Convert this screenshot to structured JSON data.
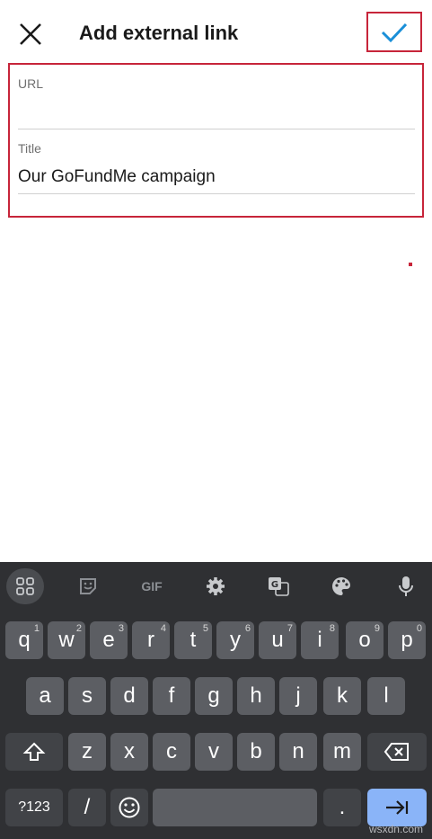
{
  "header": {
    "title": "Add external link",
    "close_icon": "close-icon",
    "confirm_icon": "check-icon"
  },
  "form": {
    "url_label": "URL",
    "url_value": "",
    "title_label": "Title",
    "title_value": "Our GoFundMe campaign"
  },
  "keyboard": {
    "toolbar": {
      "gif_label": "GIF",
      "icons": [
        "apps-grid-icon",
        "sticker-icon",
        "settings-gear-icon",
        "translate-icon",
        "palette-icon",
        "microphone-icon"
      ]
    },
    "row1": [
      "q",
      "w",
      "e",
      "r",
      "t",
      "y",
      "u",
      "i",
      "o",
      "p"
    ],
    "row1_hints": [
      "1",
      "2",
      "3",
      "4",
      "5",
      "6",
      "7",
      "8",
      "9",
      "0"
    ],
    "row2": [
      "a",
      "s",
      "d",
      "f",
      "g",
      "h",
      "j",
      "k",
      "l"
    ],
    "row3": [
      "z",
      "x",
      "c",
      "v",
      "b",
      "n",
      "m"
    ],
    "symbols_label": "?123",
    "slash_label": "/",
    "period_label": ".",
    "shift_icon": "shift-icon",
    "backspace_icon": "backspace-icon",
    "emoji_icon": "emoji-icon",
    "enter_icon": "tab-arrow-icon"
  },
  "watermark": "wsxdn.com",
  "colors": {
    "accent_blue": "#1a8fd8",
    "highlight_red": "#c7253a",
    "keyboard_bg": "#2f3033",
    "key_bg": "#5c5e63",
    "enter_key": "#8ab4f8"
  }
}
